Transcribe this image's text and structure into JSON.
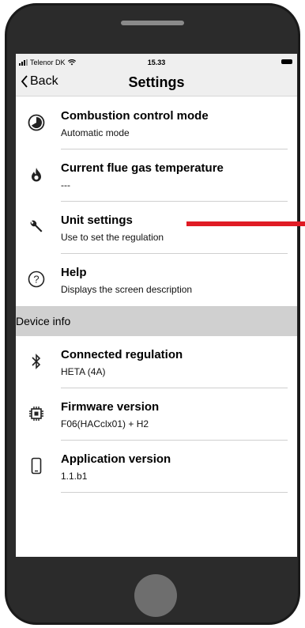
{
  "status_bar": {
    "carrier": "Telenor DK",
    "time": "15.33"
  },
  "nav": {
    "back_label": "Back",
    "title": "Settings"
  },
  "settings_items": [
    {
      "title": "Combustion control mode",
      "subtitle": "Automatic mode",
      "icon": "gauge-icon"
    },
    {
      "title": "Current flue gas temperature",
      "subtitle": "---",
      "icon": "flame-icon"
    },
    {
      "title": "Unit settings",
      "subtitle": "Use to set the regulation",
      "icon": "wrench-icon"
    },
    {
      "title": "Help",
      "subtitle": "Displays the screen description",
      "icon": "help-icon"
    }
  ],
  "device_info": {
    "header": "Device info",
    "items": [
      {
        "title": "Connected regulation",
        "subtitle": "HETA (4A)",
        "icon": "bluetooth-icon"
      },
      {
        "title": "Firmware version",
        "subtitle": "F06(HACclx01) + H2",
        "icon": "chip-icon"
      },
      {
        "title": "Application version",
        "subtitle": "1.1.b1",
        "icon": "phone-icon"
      }
    ]
  },
  "colors": {
    "annotation": "#e01b24",
    "section_header_bg": "#d0d0d0",
    "phone_body": "#2b2b2b"
  }
}
